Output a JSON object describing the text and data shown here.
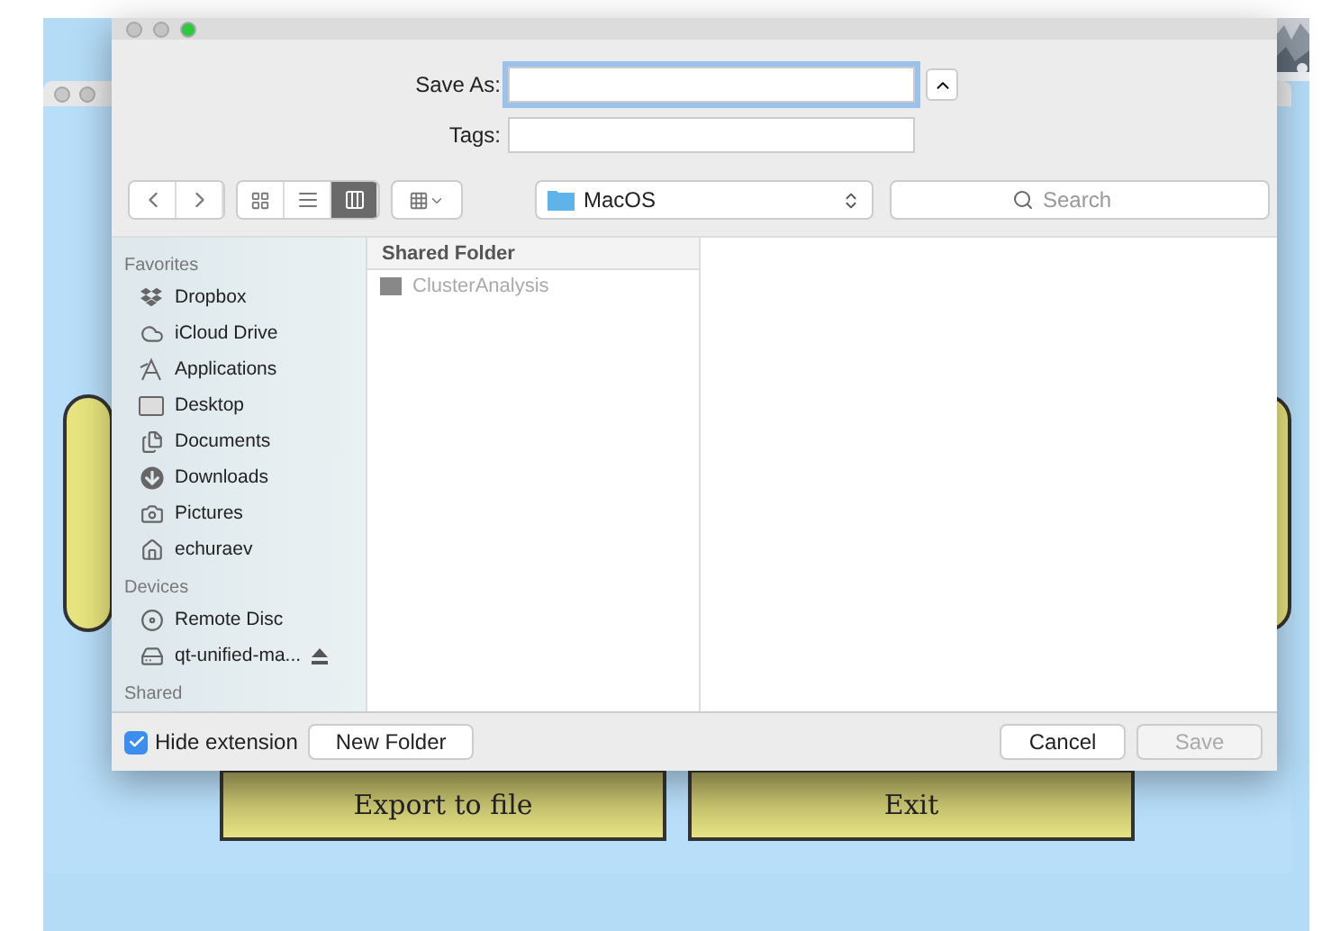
{
  "background_app": {
    "buttons": [
      "Export to file",
      "Exit"
    ]
  },
  "dialog": {
    "save_as": {
      "label": "Save As:"
    },
    "tags": {
      "label": "Tags:"
    },
    "view_modes": [
      {
        "kind": "icons",
        "selected": false
      },
      {
        "kind": "list",
        "selected": false
      },
      {
        "kind": "columns",
        "selected": true
      }
    ],
    "location": "MacOS",
    "search": {
      "placeholder": "Search"
    },
    "sidebar": [
      {
        "title": "Favorites",
        "items": [
          {
            "label": "Dropbox",
            "kind": "dropbox"
          },
          {
            "label": "iCloud Drive",
            "kind": "cloud"
          },
          {
            "label": "Applications",
            "kind": "apps"
          },
          {
            "label": "Desktop",
            "kind": "desktop"
          },
          {
            "label": "Documents",
            "kind": "documents"
          },
          {
            "label": "Downloads",
            "kind": "downloads"
          },
          {
            "label": "Pictures",
            "kind": "pictures"
          },
          {
            "label": "echuraev",
            "kind": "home"
          }
        ]
      },
      {
        "title": "Devices",
        "items": [
          {
            "label": "Remote Disc",
            "kind": "disc"
          },
          {
            "label": "qt-unified-ma...",
            "kind": "drive",
            "ejectable": true
          }
        ]
      },
      {
        "title": "Shared"
      }
    ],
    "column": {
      "header": "Shared Folder",
      "items": [
        {
          "label": "ClusterAnalysis",
          "disabled": true
        }
      ]
    },
    "hide_extension": {
      "label": "Hide extension",
      "checked": true
    },
    "buttons": [
      {
        "label": "New Folder",
        "disabled": false
      },
      {
        "label": "Cancel",
        "disabled": false
      },
      {
        "label": "Save",
        "disabled": true
      }
    ]
  }
}
